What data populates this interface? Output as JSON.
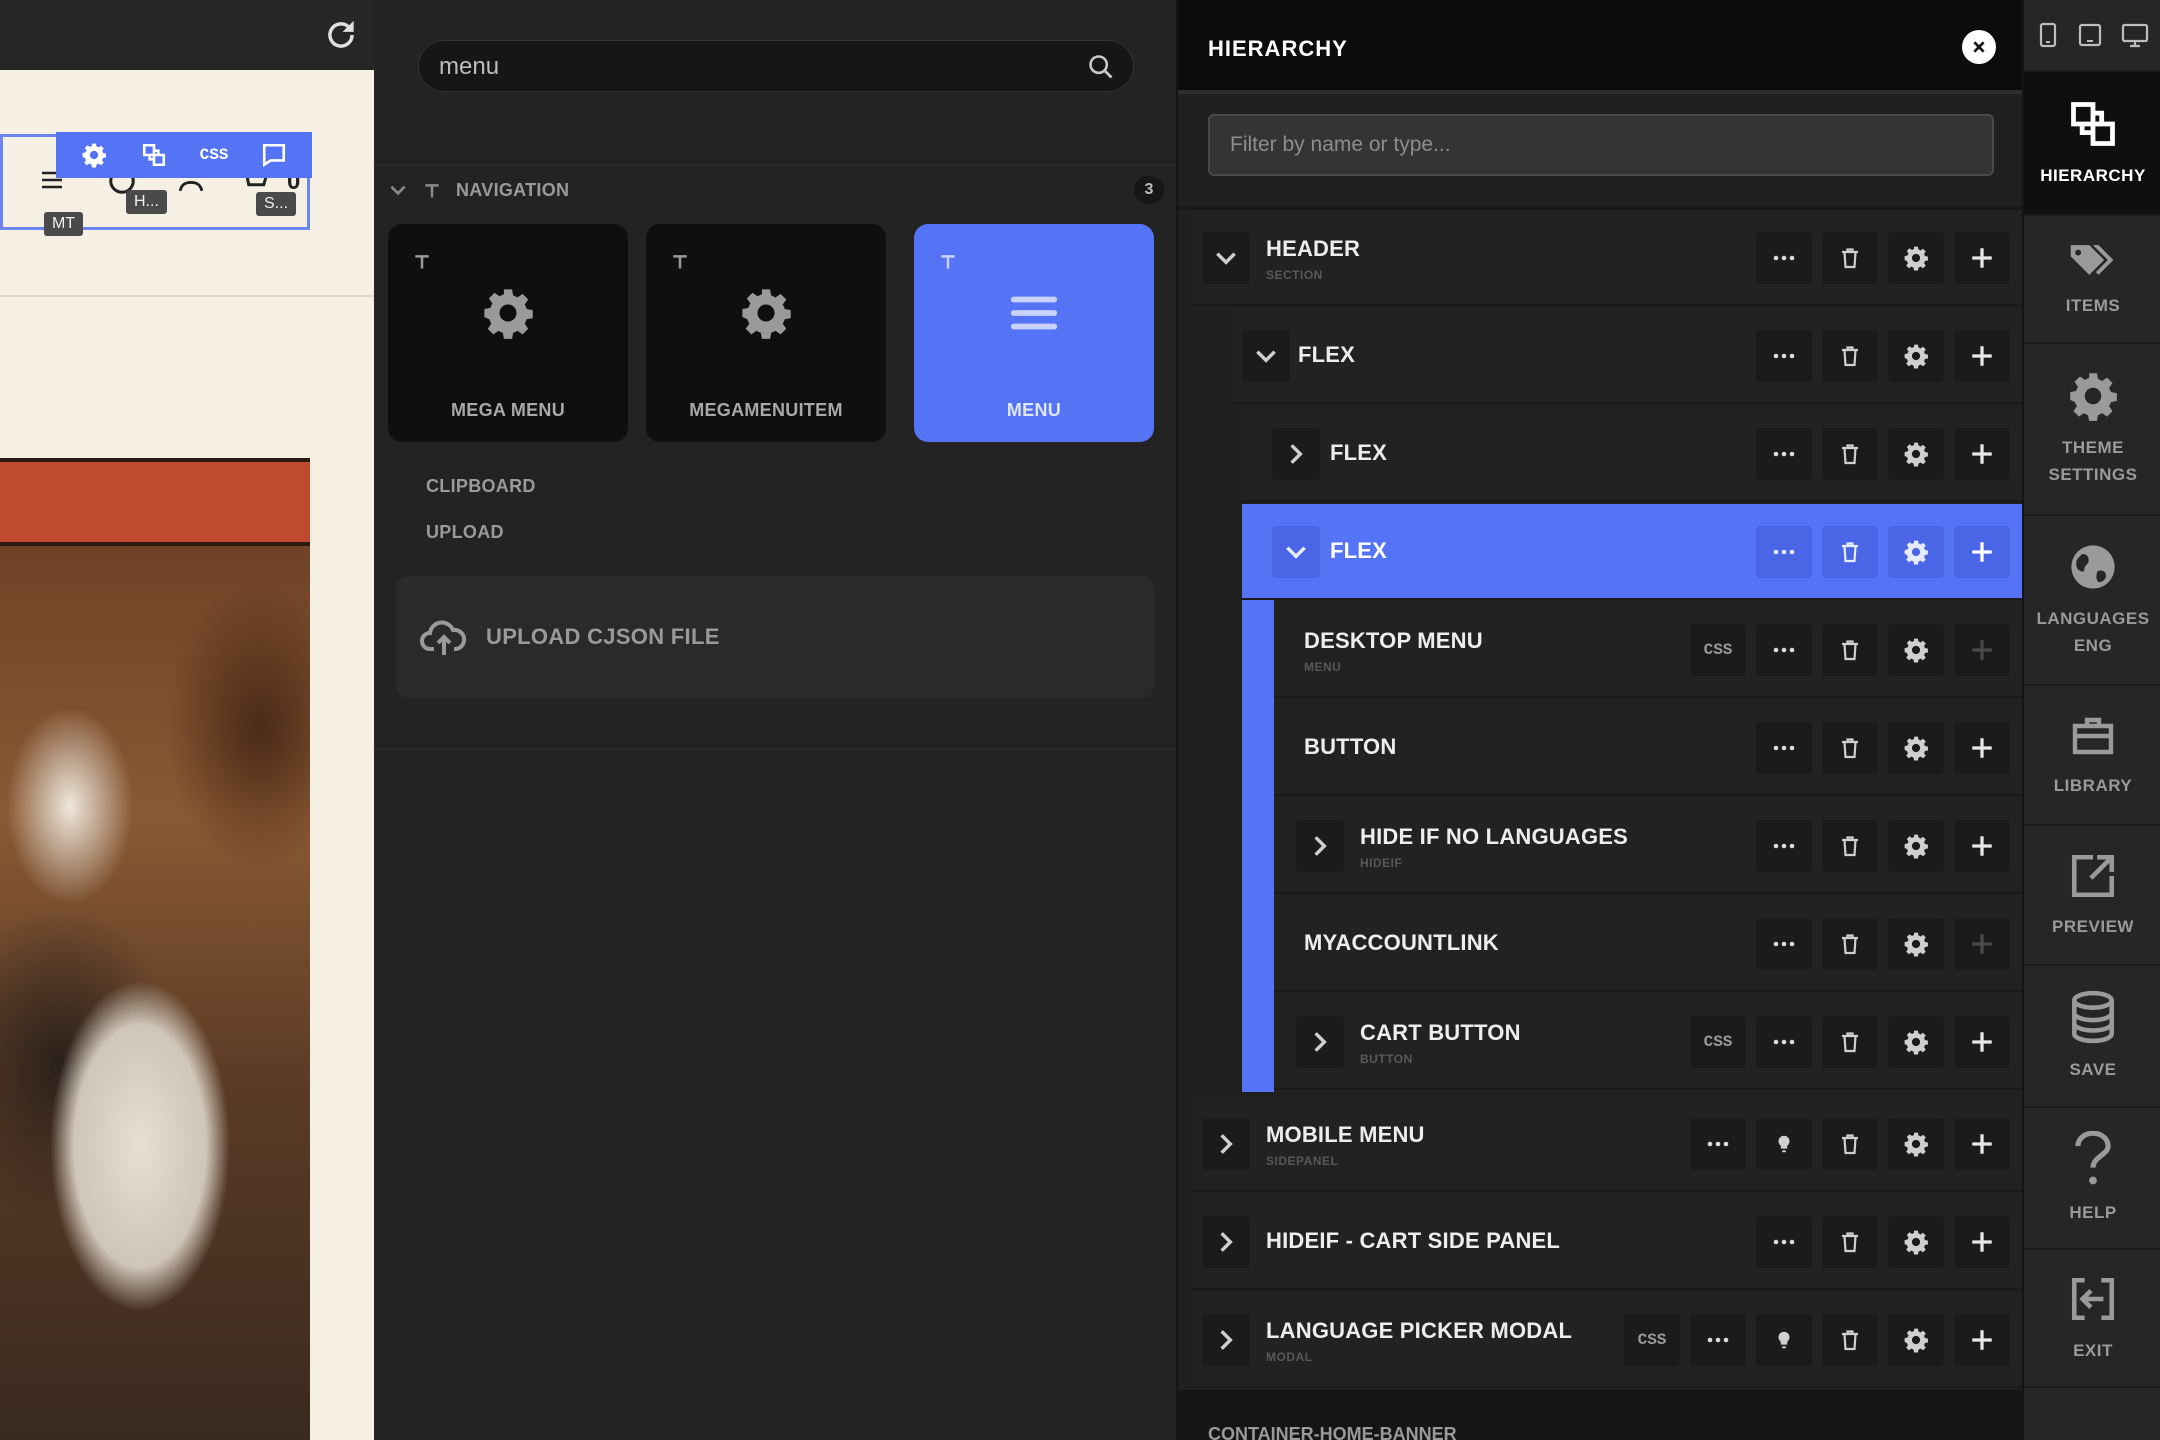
{
  "preview": {
    "tag_mt": "MT",
    "tag_h": "H...",
    "tag_s": "S...",
    "cart_count": "0",
    "toolbar_css": "CSS"
  },
  "elements": {
    "search_value": "menu",
    "search_placeholder": "menu",
    "group": {
      "label": "NAVIGATION",
      "count": "3",
      "items": [
        {
          "label": "MEGA MENU",
          "icon": "gear-icon"
        },
        {
          "label": "MEGAMENUITEM",
          "icon": "gear-icon"
        },
        {
          "label": "MENU",
          "icon": "hamburger-icon",
          "active": true
        }
      ]
    },
    "clipboard_label": "CLIPBOARD",
    "upload_label": "UPLOAD",
    "upload_button": "UPLOAD CJSON FILE"
  },
  "hierarchy": {
    "title": "HIERARCHY",
    "filter_placeholder": "Filter by name or type...",
    "css_label": "CSS",
    "rows": [
      {
        "label": "HEADER",
        "sub": "SECTION"
      },
      {
        "label": "FLEX"
      },
      {
        "label": "FLEX"
      },
      {
        "label": "FLEX"
      },
      {
        "label": "DESKTOP MENU",
        "sub": "MENU"
      },
      {
        "label": "BUTTON"
      },
      {
        "label": "HIDE IF NO LANGUAGES",
        "sub": "HIDEIF"
      },
      {
        "label": "MYACCOUNTLINK"
      },
      {
        "label": "CART BUTTON",
        "sub": "BUTTON"
      },
      {
        "label": "MOBILE MENU",
        "sub": "SIDEPANEL"
      },
      {
        "label": "HIDEIF - CART SIDE PANEL"
      },
      {
        "label": "LANGUAGE PICKER MODAL",
        "sub": "MODAL"
      },
      {
        "label": "CONTAINER-HOME-BANNER"
      }
    ]
  },
  "sidebar": {
    "items": [
      {
        "label": "HIERARCHY",
        "icon": "layers-icon",
        "active": true
      },
      {
        "label": "ITEMS",
        "icon": "tags-icon"
      },
      {
        "label": "THEME SETTINGS",
        "icon": "gear-icon"
      },
      {
        "label": "LANGUAGES ENG",
        "icon": "globe-icon"
      },
      {
        "label": "LIBRARY",
        "icon": "briefcase-icon"
      },
      {
        "label": "PREVIEW",
        "icon": "external-link-icon"
      },
      {
        "label": "SAVE",
        "icon": "database-icon"
      },
      {
        "label": "HELP",
        "icon": "question-icon"
      },
      {
        "label": "EXIT",
        "icon": "exit-icon"
      }
    ]
  },
  "colors": {
    "accent": "#5574f5",
    "background": "#232323"
  }
}
